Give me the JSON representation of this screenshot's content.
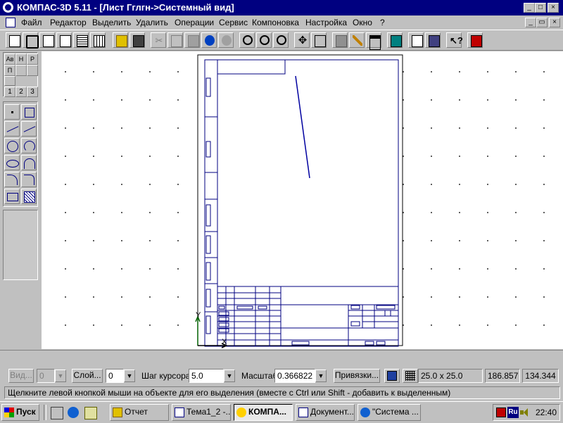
{
  "window": {
    "title": "КОМПАС-3D 5.11 - [Лист Гглгн->Системный вид]",
    "min": "_",
    "max": "□",
    "close": "×",
    "child_min": "_",
    "child_restore": "▭",
    "child_close": "×"
  },
  "menu": {
    "items": [
      "Файл",
      "Редактор",
      "Выделить",
      "Удалить",
      "Операции",
      "Сервис",
      "Компоновка",
      "Настройка",
      "Окно",
      "?"
    ]
  },
  "left_panel": {
    "tab_labels": [
      "Ав",
      "Н",
      "Р",
      "П",
      "1",
      "2",
      "3"
    ]
  },
  "status": {
    "view_label": "Вид...",
    "view_value": "0",
    "layer_label": "Слой...",
    "layer_value": "0",
    "cursor_step_label": "Шаг курсора",
    "cursor_step_value": "5.0",
    "scale_label": "Масштаб",
    "scale_value": "0.366822",
    "snaps_label": "Привязки...",
    "grid_value": "25.0 x 25.0",
    "coord_x": "186.857",
    "coord_y": "134.344"
  },
  "hint": "Щелкните левой кнопкой мыши на объекте для его выделения (вместе с Ctrl или Shift - добавить к выделенным)",
  "taskbar": {
    "start": "Пуск",
    "tasks": [
      "Отчет",
      "Тема1_2 -...",
      "КОМПА...",
      "Документ...",
      "\"Система ..."
    ],
    "active_task": 2,
    "lang": "Ru",
    "clock": "22:40"
  },
  "colors": {
    "title_bg": "#000080",
    "face": "#c0c0c0",
    "drawing": "#000080",
    "axis_y": "#006000"
  }
}
